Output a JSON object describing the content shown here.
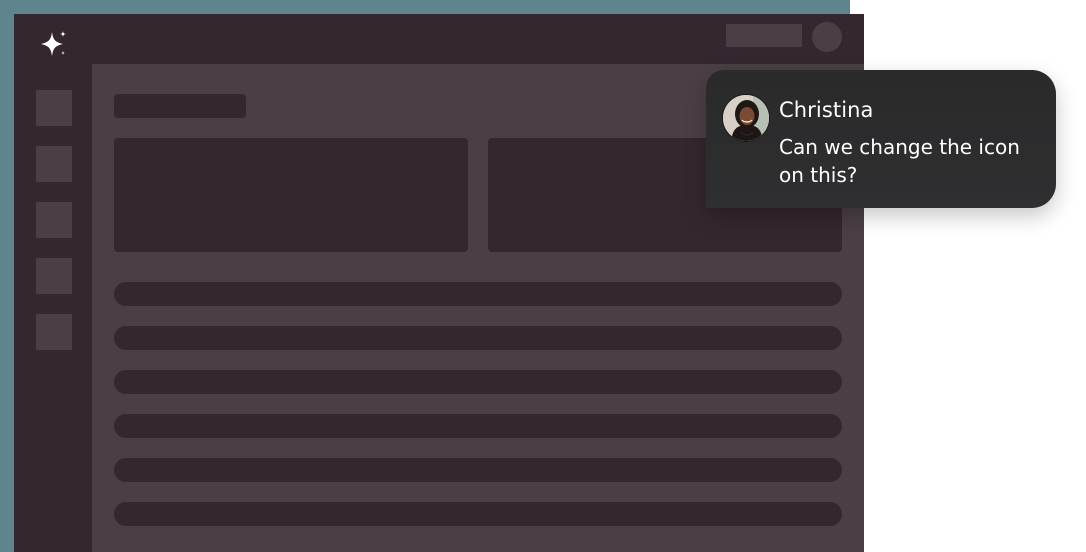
{
  "colors": {
    "backdrop": "#5f848d",
    "window": "#342730",
    "panel": "#4a3f45",
    "placeholder": "#342730",
    "bubble": "#2c2c2d",
    "text": "#ffffff"
  },
  "logo": {
    "icon": "sparkle-icon"
  },
  "header": {
    "action_button": "",
    "profile_avatar": ""
  },
  "sidebar": {
    "items": [
      "",
      "",
      "",
      "",
      ""
    ]
  },
  "comment": {
    "author": "Christina",
    "message": "Can we change the icon on this?",
    "avatar": "user-photo"
  }
}
